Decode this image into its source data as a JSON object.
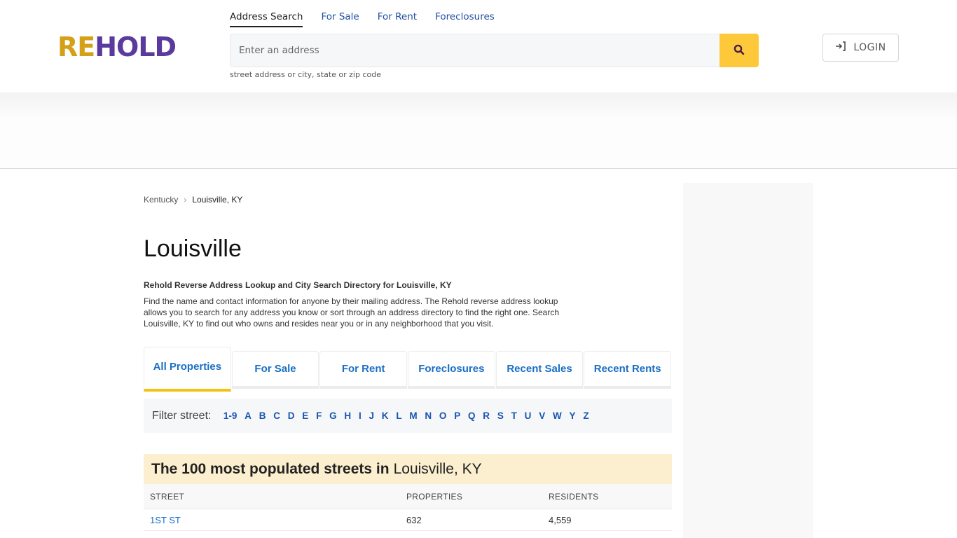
{
  "header": {
    "logo": {
      "part1": "RE",
      "part2": "HOLD"
    },
    "nav": [
      {
        "label": "Address Search",
        "active": true
      },
      {
        "label": "For Sale",
        "active": false
      },
      {
        "label": "For Rent",
        "active": false
      },
      {
        "label": "Foreclosures",
        "active": false
      }
    ],
    "search": {
      "value": "",
      "placeholder": "Enter an address",
      "hint": "street address or city, state or zip code",
      "icon": "search-icon"
    },
    "login": {
      "label": "LOGIN",
      "icon": "login-icon"
    }
  },
  "breadcrumb": {
    "items": [
      {
        "label": "Kentucky"
      },
      {
        "label": "Louisville, KY"
      }
    ]
  },
  "page": {
    "title": "Louisville",
    "subheading": "Rehold Reverse Address Lookup and City Search Directory for Louisville, KY",
    "description": "Find the name and contact information for anyone by their mailing address. The Rehold reverse address lookup allows you to search for any address you know or sort through an address directory to find the right one. Search Louisville, KY to find out who owns and resides near you or in any neighborhood that you visit."
  },
  "tabs": [
    {
      "label": "All Properties",
      "active": true
    },
    {
      "label": "For Sale",
      "active": false
    },
    {
      "label": "For Rent",
      "active": false
    },
    {
      "label": "Foreclosures",
      "active": false
    },
    {
      "label": "Recent Sales",
      "active": false
    },
    {
      "label": "Recent Rents",
      "active": false
    }
  ],
  "filter": {
    "label": "Filter street:",
    "letters": [
      "1-9",
      "A",
      "B",
      "C",
      "D",
      "E",
      "F",
      "G",
      "H",
      "I",
      "J",
      "K",
      "L",
      "M",
      "N",
      "O",
      "P",
      "Q",
      "R",
      "S",
      "T",
      "U",
      "V",
      "W",
      "Y",
      "Z"
    ]
  },
  "streets_table": {
    "title_bold": "The 100 most populated streets in",
    "title_rest": "Louisville, KY",
    "columns": [
      "STREET",
      "PROPERTIES",
      "RESIDENTS"
    ],
    "rows": [
      {
        "street": "1ST ST",
        "properties": "632",
        "residents": "4,559"
      }
    ]
  },
  "colors": {
    "brand_gold": "#d4a017",
    "brand_purple": "#5b3a9e",
    "search_button": "#fdc93a",
    "link_blue": "#1a6fc4",
    "active_tab_underline": "#f2c20f",
    "table_title_bg": "#fcefcf"
  }
}
